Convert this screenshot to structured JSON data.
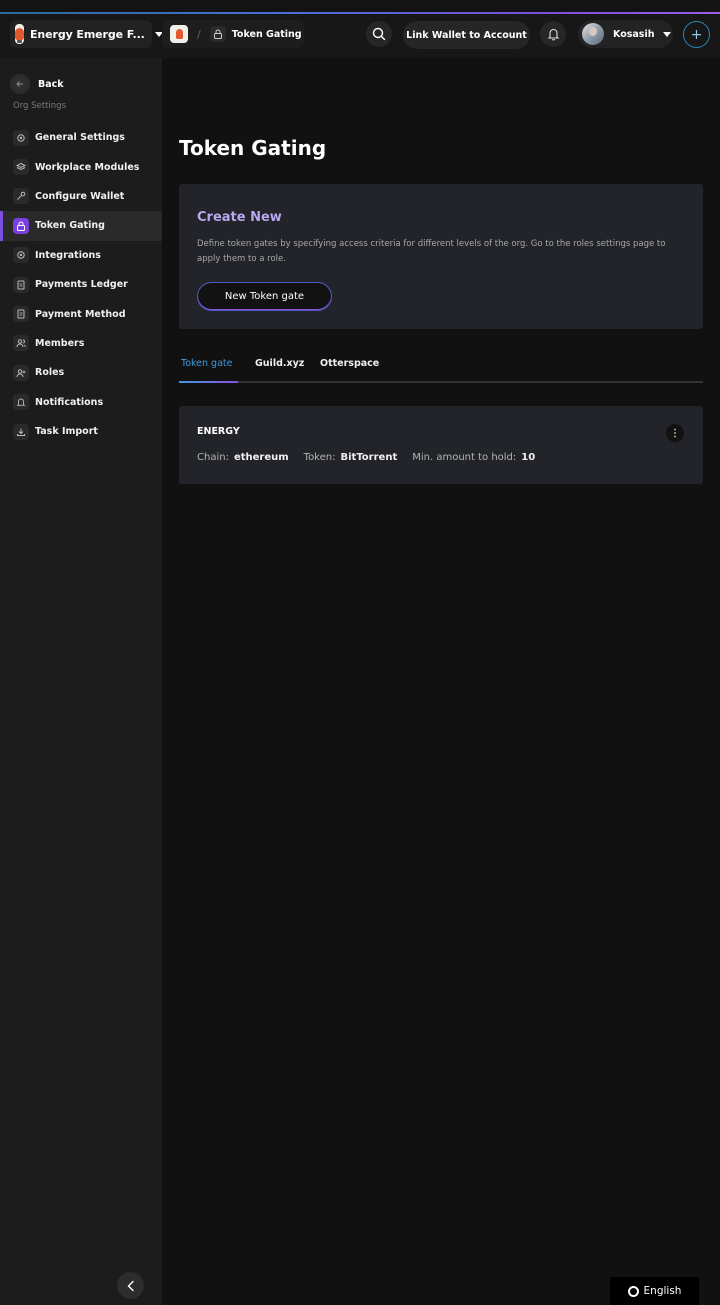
{
  "org": {
    "name": "Energy Emerge F..."
  },
  "breadcrumb": {
    "current": "Token Gating"
  },
  "header": {
    "link_wallet": "Link Wallet to Account",
    "user_name": "Kosasih"
  },
  "sidebar": {
    "back": "Back",
    "section_title": "Org Settings",
    "items": [
      {
        "label": "General Settings",
        "icon": "gear-icon"
      },
      {
        "label": "Workplace Modules",
        "icon": "layers-icon"
      },
      {
        "label": "Configure Wallet",
        "icon": "key-icon"
      },
      {
        "label": "Token Gating",
        "icon": "lock-icon",
        "active": true
      },
      {
        "label": "Integrations",
        "icon": "gear-icon"
      },
      {
        "label": "Payments Ledger",
        "icon": "document-icon"
      },
      {
        "label": "Payment Method",
        "icon": "document-icon"
      },
      {
        "label": "Members",
        "icon": "users-icon"
      },
      {
        "label": "Roles",
        "icon": "user-plus-icon"
      },
      {
        "label": "Notifications",
        "icon": "bell-icon"
      },
      {
        "label": "Task Import",
        "icon": "import-icon"
      }
    ]
  },
  "main": {
    "title": "Token Gating",
    "create": {
      "title": "Create New",
      "description": "Define token gates by specifying access criteria for different levels of the org. Go to the roles settings page to apply them to a role.",
      "button": "New Token gate"
    },
    "tabs": [
      {
        "label": "Token gate",
        "active": true
      },
      {
        "label": "Guild.xyz"
      },
      {
        "label": "Otterspace"
      }
    ],
    "gates": [
      {
        "name": "ENERGY",
        "chain_label": "Chain:",
        "chain": "ethereum",
        "token_label": "Token:",
        "token": "BitTorrent",
        "min_label": "Min. amount to hold:",
        "min": "10"
      }
    ]
  },
  "footer": {
    "language": "English"
  },
  "colors": {
    "accent": "#7b4fe0",
    "tab_active": "#3f9ae0",
    "card_bg": "#222429",
    "create_title": "#b9a8f0"
  }
}
